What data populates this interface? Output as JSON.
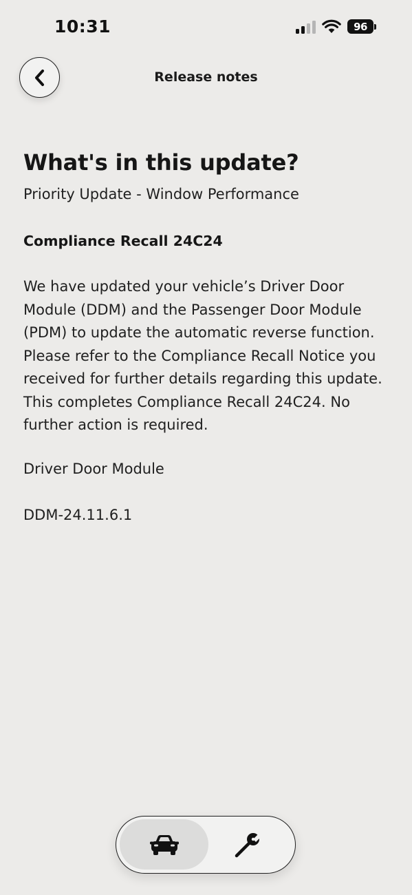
{
  "status_bar": {
    "time": "10:31",
    "battery": "96",
    "icons": [
      "cellular-signal-icon",
      "wifi-icon",
      "battery-icon"
    ]
  },
  "header": {
    "title": "Release notes",
    "back_icon": "chevron-left-icon"
  },
  "content": {
    "heading": "What's in this update?",
    "subtitle": "Priority Update - Window Performance",
    "recall_title": "Compliance Recall 24C24",
    "recall_body": "We have updated your vehicle’s Driver Door Module (DDM) and the Passenger Door Module (PDM) to update the automatic reverse function. Please refer to the Compliance Recall Notice you received for further details regarding this update. This completes Compliance Recall 24C24. No further action is required.",
    "module_name": "Driver Door Module",
    "module_version": "DDM-24.11.6.1"
  },
  "tab_bar": {
    "tabs": [
      {
        "icon": "car-icon",
        "selected": true
      },
      {
        "icon": "wrench-icon",
        "selected": false
      }
    ]
  },
  "colors": {
    "background": "#ecebe9",
    "text": "#1a1a1a",
    "selected_tab": "#dcdcdb"
  }
}
